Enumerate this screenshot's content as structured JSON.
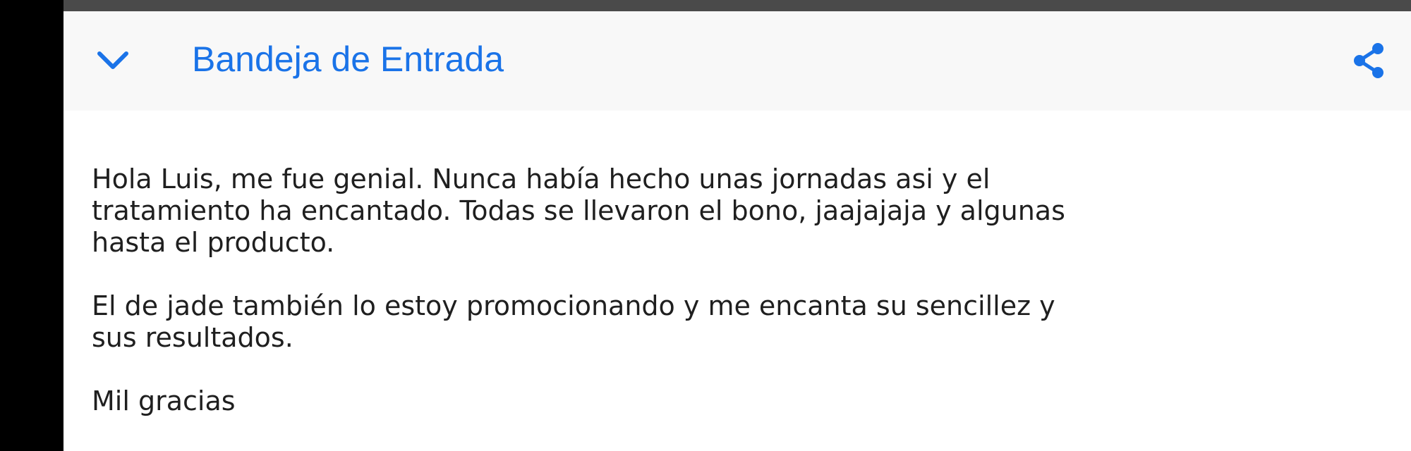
{
  "header": {
    "title": "Bandeja de Entrada",
    "collapse_icon": "chevron-down-icon",
    "share_icon": "share-icon",
    "accent_color": "#1a73e8"
  },
  "message": {
    "paragraphs": [
      {
        "lines": [
          "Hola Luis, me fue genial. Nunca había hecho unas jornadas asi y el",
          "tratamiento ha encantado. Todas se llevaron el bono, jaajajaja y algunas",
          "hasta el producto."
        ]
      },
      {
        "lines": [
          "El de jade también lo estoy promocionando y me encanta su sencillez y",
          "sus resultados."
        ]
      },
      {
        "lines": [
          "Mil gracias"
        ]
      }
    ]
  }
}
